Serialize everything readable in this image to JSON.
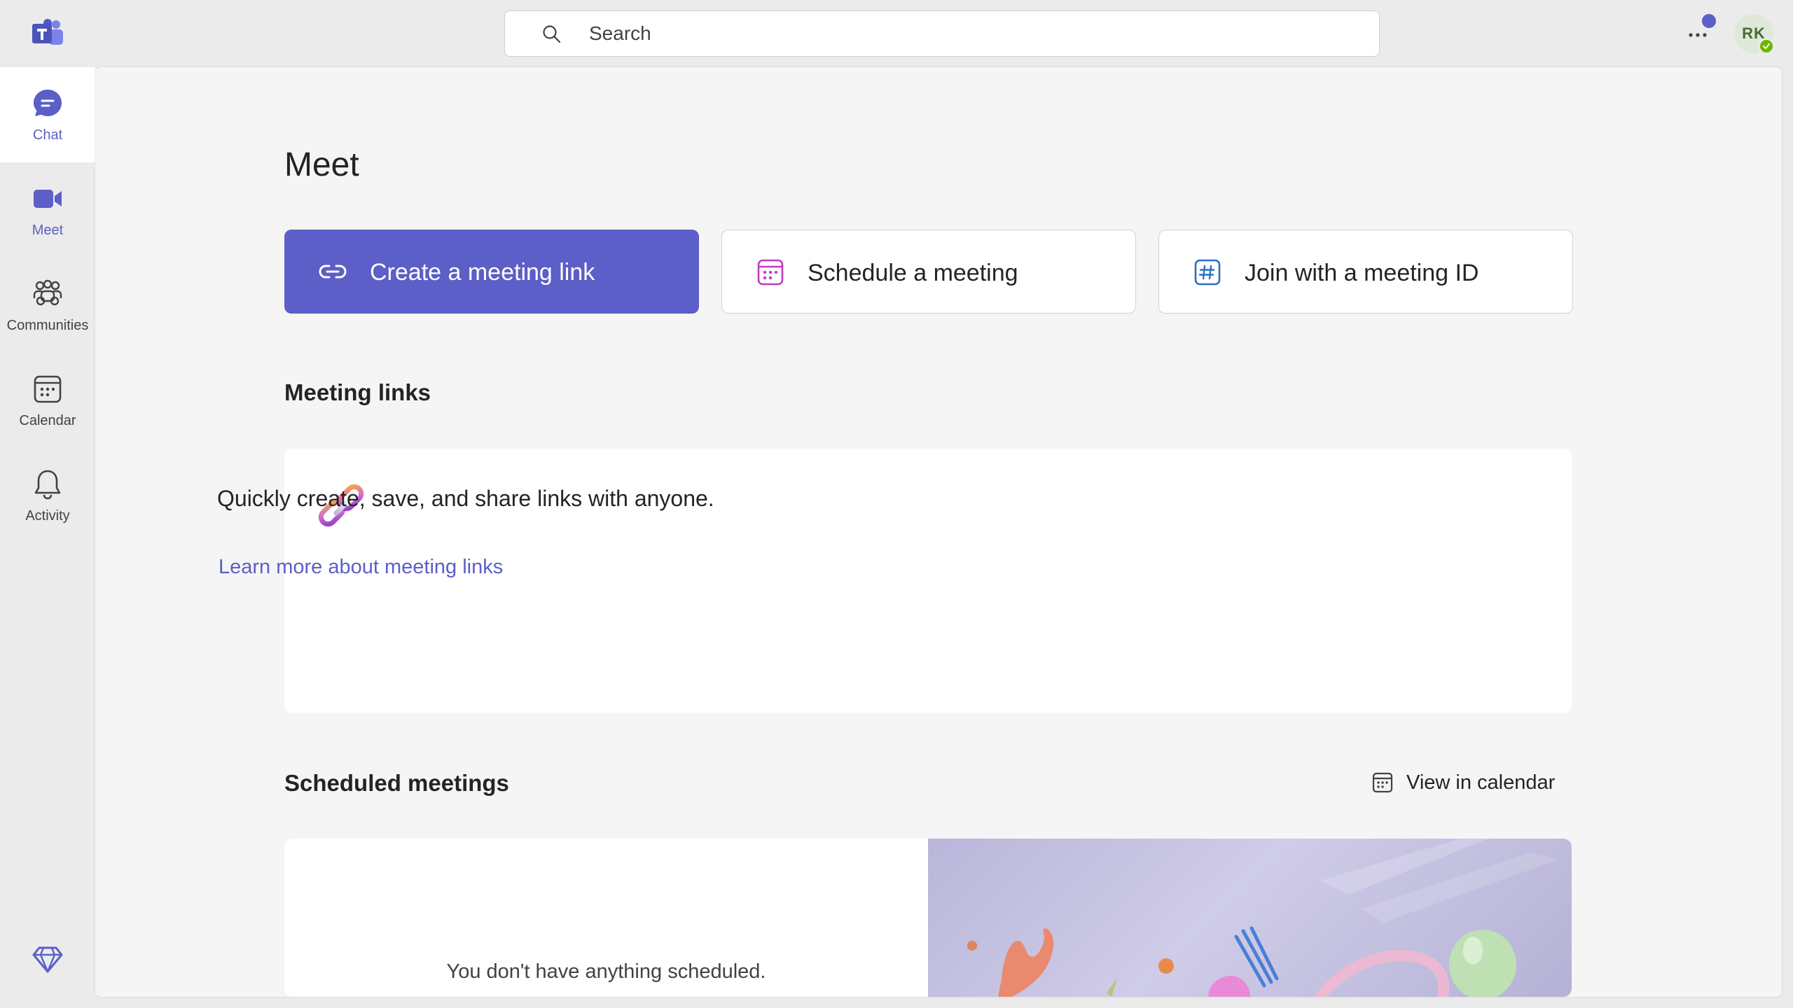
{
  "app": {
    "logo_icon": "teams-logo-icon"
  },
  "search": {
    "placeholder": "Search"
  },
  "topbar": {
    "more_icon": "more-horizontal-icon"
  },
  "user": {
    "initials": "RK",
    "presence": "available"
  },
  "rail": {
    "items": [
      {
        "label": "Chat",
        "icon": "chat-icon"
      },
      {
        "label": "Meet",
        "icon": "video-camera-icon"
      },
      {
        "label": "Communities",
        "icon": "communities-icon"
      },
      {
        "label": "Calendar",
        "icon": "calendar-icon"
      },
      {
        "label": "Activity",
        "icon": "bell-icon"
      }
    ],
    "premium_icon": "diamond-icon"
  },
  "main": {
    "title": "Meet",
    "actions": [
      {
        "label": "Create a meeting link",
        "icon": "link-icon"
      },
      {
        "label": "Schedule a meeting",
        "icon": "calendar-icon"
      },
      {
        "label": "Join with a meeting ID",
        "icon": "hashtag-icon"
      }
    ],
    "meeting_links": {
      "title": "Meeting links",
      "description": "Quickly create, save, and share links with anyone.",
      "learn_more": "Learn more about meeting links"
    },
    "scheduled": {
      "title": "Scheduled meetings",
      "view_in_calendar": "View in calendar",
      "empty_text": "You don't have anything scheduled."
    }
  },
  "colors": {
    "brand": "#5b5fc7",
    "background": "#ebebeb",
    "panel": "#f5f5f5",
    "presence_available": "#6bb700"
  }
}
